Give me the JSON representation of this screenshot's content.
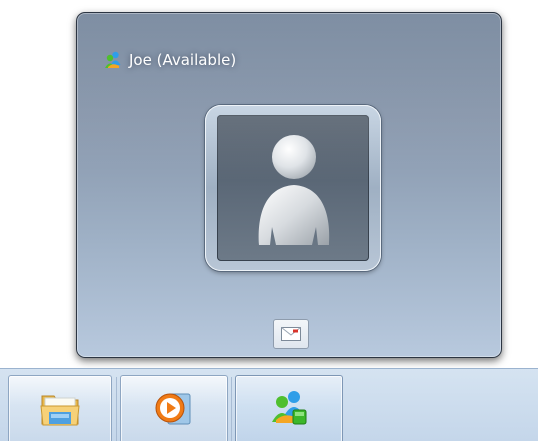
{
  "preview": {
    "title": "Joe (Available)",
    "title_icon": "messenger-buddies-icon",
    "avatar": "default-user-avatar-icon",
    "action_button_icon": "email-icon"
  },
  "taskbar": {
    "buttons": [
      {
        "name": "windows-explorer",
        "icon": "folder-icon",
        "active": false
      },
      {
        "name": "windows-media-player",
        "icon": "media-player-icon",
        "active": false
      },
      {
        "name": "windows-live-messenger",
        "icon": "messenger-icon",
        "active": true
      }
    ]
  },
  "colors": {
    "status_online": "#3cb72a",
    "taskbar_bg": "#c9d9ec",
    "preview_bg": "#8a9bb0"
  }
}
